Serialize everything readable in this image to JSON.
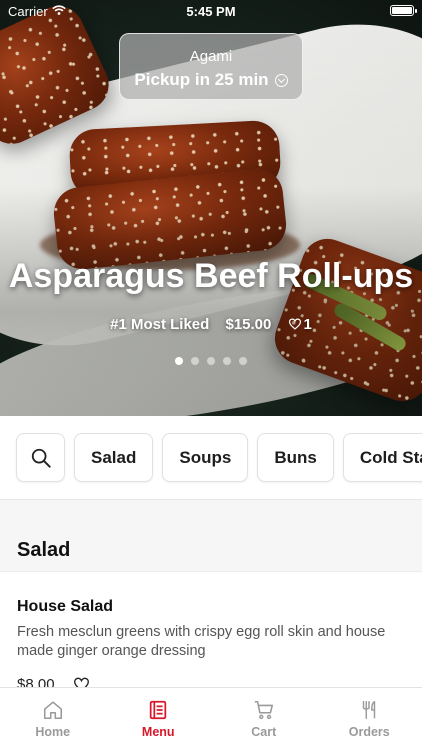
{
  "status_bar": {
    "carrier": "Carrier",
    "time": "5:45 PM"
  },
  "pickup": {
    "store": "Agami",
    "eta": "Pickup in 25 min"
  },
  "featured": {
    "title": "Asparagus Beef Roll-ups",
    "badge": "#1 Most Liked",
    "price": "$15.00",
    "likes": "1",
    "carousel_pages": 5,
    "carousel_active": 1
  },
  "categories": {
    "search_icon": "search-icon",
    "items": [
      "Salad",
      "Soups",
      "Buns",
      "Cold Star"
    ]
  },
  "menu": {
    "section_title": "Salad",
    "items": [
      {
        "name": "House Salad",
        "description": "Fresh mesclun greens with crispy egg roll skin and house made ginger orange dressing",
        "price": "$8.00",
        "favorite_icon": "heart-outline-icon"
      }
    ]
  },
  "tab_bar": {
    "accent_color": "#d8172a",
    "inactive_color": "#9a9a9a",
    "tabs": [
      {
        "label": "Home",
        "icon": "home-icon",
        "active": false
      },
      {
        "label": "Menu",
        "icon": "menu-list-icon",
        "active": true
      },
      {
        "label": "Cart",
        "icon": "cart-icon",
        "active": false
      },
      {
        "label": "Orders",
        "icon": "fork-knife-icon",
        "active": false
      }
    ]
  }
}
